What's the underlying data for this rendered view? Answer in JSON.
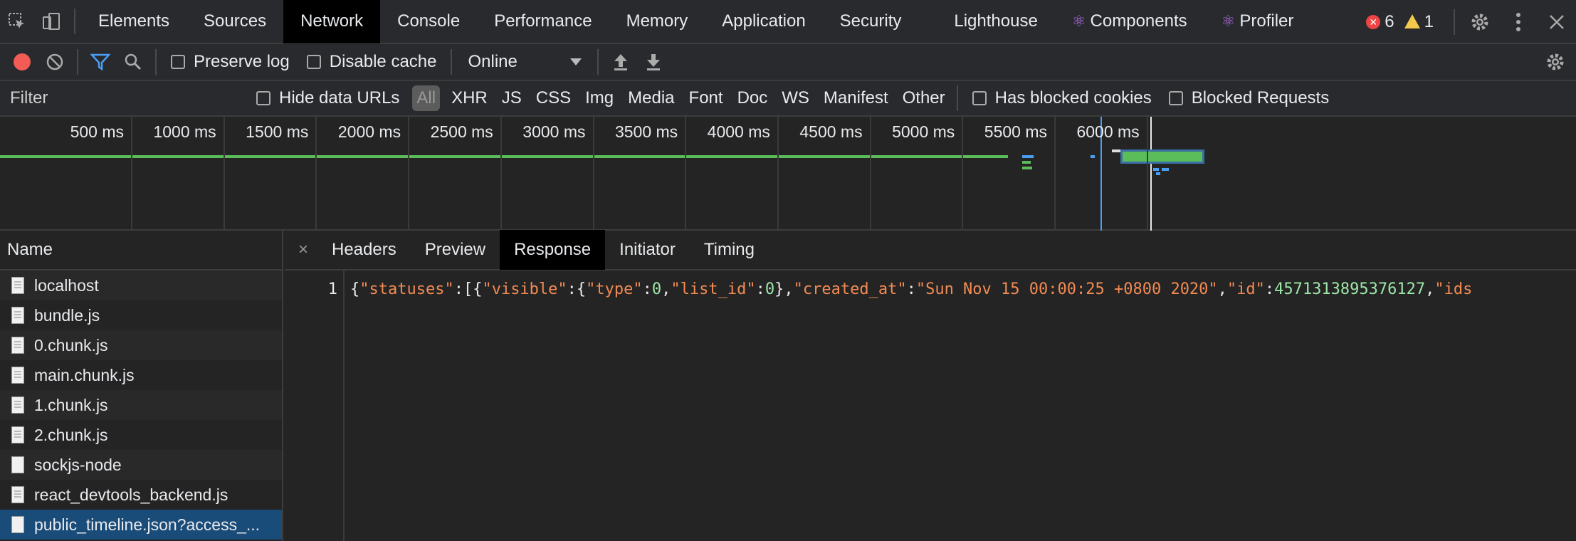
{
  "tabbar": {
    "tabs": [
      {
        "label": "Elements",
        "active": false
      },
      {
        "label": "Sources",
        "active": false
      },
      {
        "label": "Network",
        "active": true
      },
      {
        "label": "Console",
        "active": false
      },
      {
        "label": "Performance",
        "active": false
      },
      {
        "label": "Memory",
        "active": false
      },
      {
        "label": "Application",
        "active": false
      },
      {
        "label": "Security",
        "active": false
      },
      {
        "label": "Lighthouse",
        "active": false
      }
    ],
    "react_tabs": [
      {
        "label": "Components"
      },
      {
        "label": "Profiler"
      }
    ],
    "errors_count": "6",
    "warnings_count": "1"
  },
  "toolbar": {
    "preserve_log": "Preserve log",
    "disable_cache": "Disable cache",
    "throttle": "Online"
  },
  "filterbar": {
    "filter_placeholder": "Filter",
    "hide_data_urls": "Hide data URLs",
    "types": [
      "All",
      "XHR",
      "JS",
      "CSS",
      "Img",
      "Media",
      "Font",
      "Doc",
      "WS",
      "Manifest",
      "Other"
    ],
    "has_blocked_cookies": "Has blocked cookies",
    "blocked_requests": "Blocked Requests"
  },
  "timeline": {
    "ticks": [
      "500 ms",
      "1000 ms",
      "1500 ms",
      "2000 ms",
      "2500 ms",
      "3000 ms",
      "3500 ms",
      "4000 ms",
      "4500 ms",
      "5000 ms",
      "5500 ms",
      "6000 ms"
    ]
  },
  "names": {
    "header": "Name",
    "files": [
      {
        "name": "localhost",
        "selected": false
      },
      {
        "name": "bundle.js",
        "selected": false
      },
      {
        "name": "0.chunk.js",
        "selected": false
      },
      {
        "name": "main.chunk.js",
        "selected": false
      },
      {
        "name": "1.chunk.js",
        "selected": false
      },
      {
        "name": "2.chunk.js",
        "selected": false
      },
      {
        "name": "sockjs-node",
        "selected": false
      },
      {
        "name": "react_devtools_backend.js",
        "selected": false
      },
      {
        "name": "public_timeline.json?access_...",
        "selected": true
      }
    ]
  },
  "detail": {
    "tabs": [
      {
        "label": "Headers",
        "active": false
      },
      {
        "label": "Preview",
        "active": false
      },
      {
        "label": "Response",
        "active": true
      },
      {
        "label": "Initiator",
        "active": false
      },
      {
        "label": "Timing",
        "active": false
      }
    ],
    "line_number": "1",
    "code": {
      "open": "{",
      "k_statuses": "\"statuses\"",
      "arr_open": ":[{",
      "k_visible": "\"visible\"",
      "colon_brace": ":{",
      "k_type": "\"type\"",
      "colon1": ":",
      "v_type": "0",
      "comma1": ",",
      "k_list_id": "\"list_id\"",
      "colon2": ":",
      "v_list_id": "0",
      "close_comma": "},",
      "k_created_at": "\"created_at\"",
      "colon3": ":",
      "v_created_at": "\"Sun Nov 15 00:00:25 +0800 2020\"",
      "comma2": ",",
      "k_id": "\"id\"",
      "colon4": ":",
      "v_id": "4571313895376127",
      "comma3": ",",
      "k_ids": "\"ids"
    }
  }
}
